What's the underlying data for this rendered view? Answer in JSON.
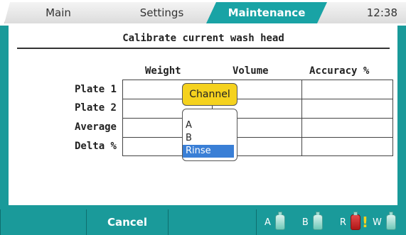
{
  "tabs": {
    "main": "Main",
    "settings": "Settings",
    "maintenance": "Maintenance",
    "time": "12:38"
  },
  "title": "Calibrate current wash head",
  "table": {
    "columns": [
      "Weight",
      "Volume",
      "Accuracy %"
    ],
    "rows": [
      "Plate 1",
      "Plate 2",
      "Average",
      "Delta %"
    ]
  },
  "channel_popup": {
    "button_label": "Channel",
    "options": [
      "A",
      "B",
      "Rinse"
    ],
    "selected": "Rinse"
  },
  "bottom": {
    "cancel_label": "Cancel",
    "status": [
      {
        "label": "A",
        "icon": "bottle-icon",
        "state": "ok"
      },
      {
        "label": "B",
        "icon": "bottle-icon",
        "state": "ok"
      },
      {
        "label": "R",
        "icon": "bottle-icon",
        "state": "warning",
        "color": "#c42020"
      },
      {
        "label": "W",
        "icon": "bottle-icon",
        "state": "ok"
      }
    ]
  },
  "colors": {
    "accent": "#1a9a9a",
    "popup": "#f5d21e",
    "selection": "#3a7fd6"
  }
}
